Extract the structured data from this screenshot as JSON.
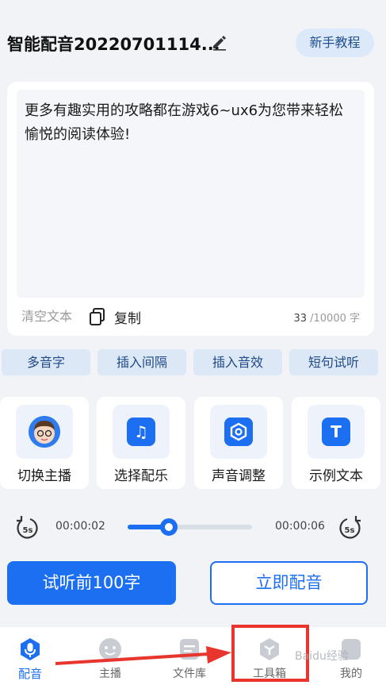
{
  "header": {
    "title": "智能配音20220701114...",
    "tutorial_label": "新手教程"
  },
  "editor": {
    "text": "更多有趣实用的攻略都在游戏6~ux6为您带来轻松愉悦的阅读体验!",
    "clear_label": "清空文本",
    "copy_label": "复制",
    "count": "33",
    "count_limit": "/10000 字"
  },
  "chips": [
    "多音字",
    "插入间隔",
    "插入音效",
    "短句试听"
  ],
  "tools": [
    {
      "label": "切换主播",
      "icon": "avatar-icon"
    },
    {
      "label": "选择配乐",
      "icon": "music-note-icon"
    },
    {
      "label": "声音调整",
      "icon": "settings-gear-icon"
    },
    {
      "label": "示例文本",
      "icon": "text-t-icon"
    }
  ],
  "player": {
    "current_time": "00:00:02",
    "total_time": "00:00:06",
    "skip_back_label": "5s",
    "skip_forward_label": "5s",
    "progress": 0.33
  },
  "actions": {
    "preview_label": "试听前100字",
    "dub_label": "立即配音"
  },
  "nav": [
    {
      "label": "配音",
      "icon": "mic-icon",
      "active": true
    },
    {
      "label": "主播",
      "icon": "face-icon",
      "active": false
    },
    {
      "label": "文件库",
      "icon": "file-icon",
      "active": false
    },
    {
      "label": "工具箱",
      "icon": "toolbox-icon",
      "active": false
    },
    {
      "label": "我的",
      "icon": "profile-icon",
      "active": false
    }
  ],
  "watermark": "Baidu经验",
  "colors": {
    "accent": "#1d6ff2",
    "annotation": "#e8352e"
  }
}
